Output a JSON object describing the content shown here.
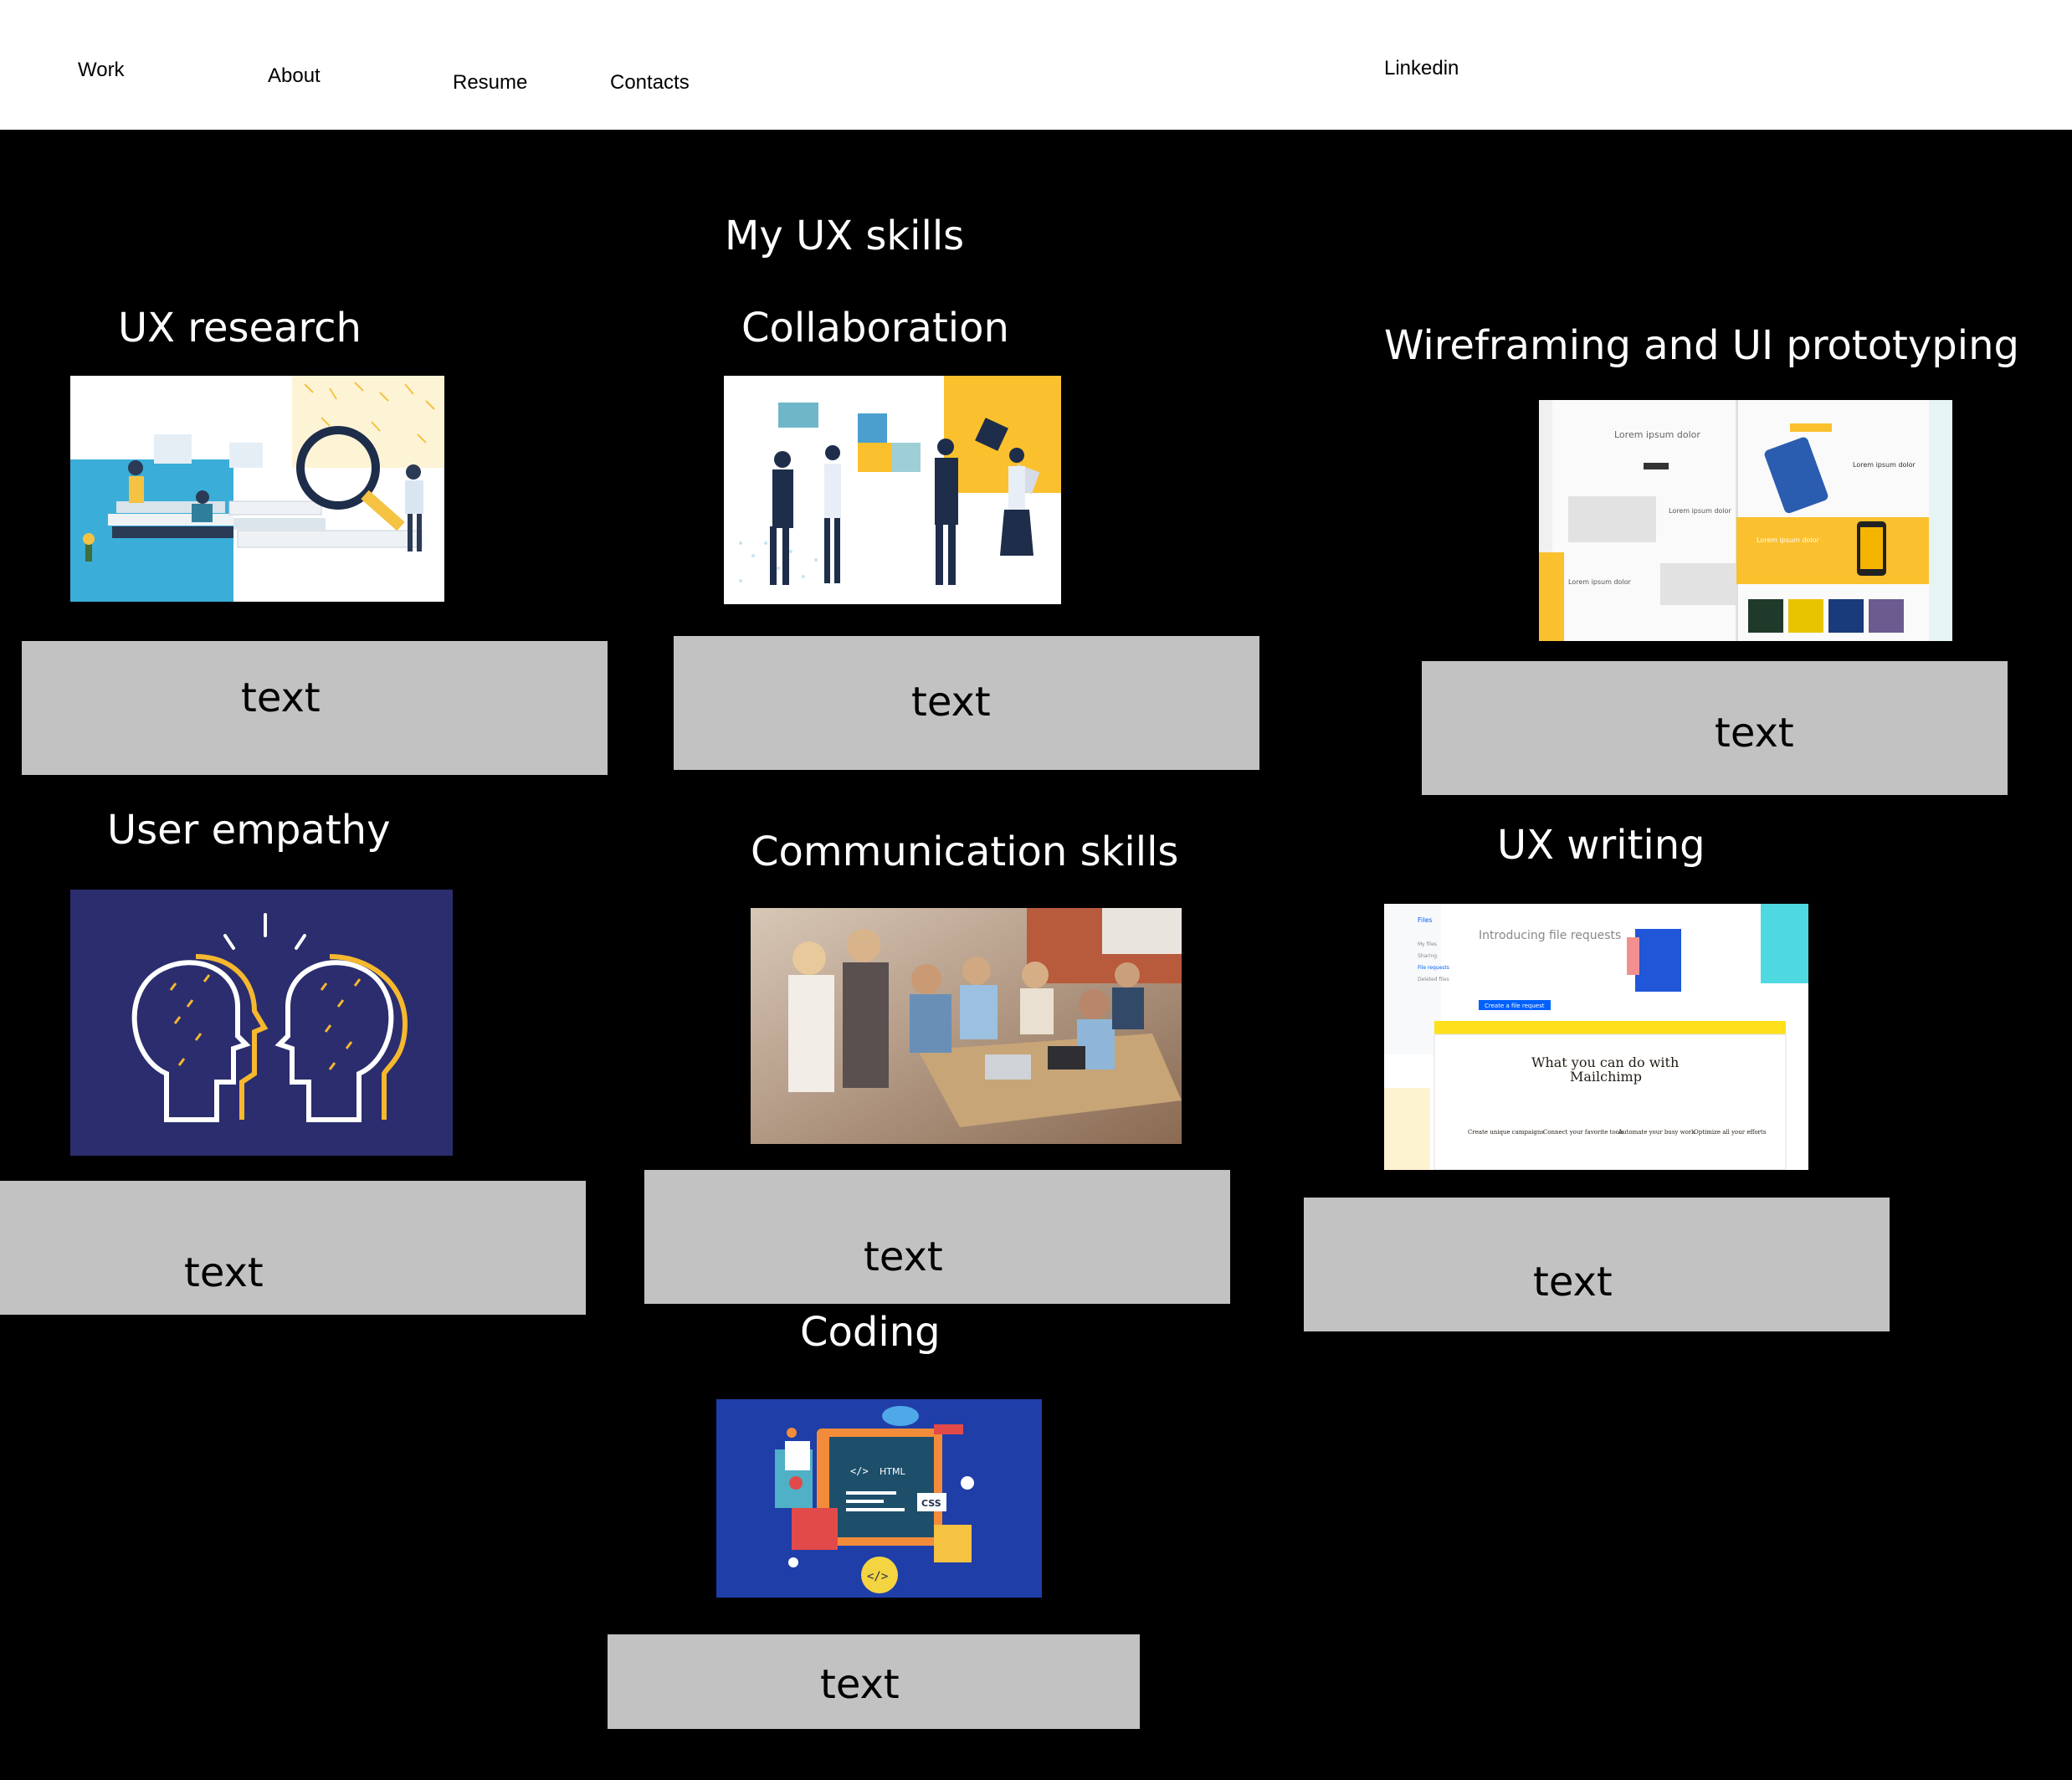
{
  "nav": {
    "work": "Work",
    "about": "About",
    "resume": "Resume",
    "contacts": "Contacts",
    "linkedin": "Linkedin"
  },
  "page_title": "My UX skills",
  "skills": [
    {
      "title": "UX research",
      "text": "text"
    },
    {
      "title": "Collaboration",
      "text": "text"
    },
    {
      "title": "Wireframing and UI prototyping",
      "text": "text"
    },
    {
      "title": "User empathy",
      "text": "text"
    },
    {
      "title": "Communication skills",
      "text": "text"
    },
    {
      "title": "UX writing",
      "text": "text"
    },
    {
      "title": "Coding",
      "text": "text"
    }
  ],
  "wireframe_mock": {
    "text_1": "Lorem ipsum dolor",
    "text_2": "Lorem ipsum dolor",
    "text_3": "Lorem ipsum dolor",
    "text_4": "Lorem ipsum dolor",
    "text_5": "Lorem ipsum dolor"
  },
  "ux_writing_mock": {
    "sidebar_title": "Files",
    "sidebar_items": [
      "My files",
      "Sharing",
      "File requests",
      "Deleted files"
    ],
    "headline": "Introducing file requests",
    "cta": "Create a file request",
    "card_title_line1": "What you can do with",
    "card_title_line2": "Mailchimp",
    "features": [
      "Create unique campaigns",
      "Connect your favorite tools",
      "Automate your busy work",
      "Optimize all your efforts"
    ]
  },
  "coding_mock": {
    "html_label": "HTML",
    "css_label": "CSS"
  },
  "colors": {
    "background": "#000000",
    "nav_bg": "#ffffff",
    "text_box": "#c2c2c2",
    "accent_yellow": "#fbc02d",
    "navy": "#2b2d6e",
    "coding_blue": "#1f3ea8"
  }
}
